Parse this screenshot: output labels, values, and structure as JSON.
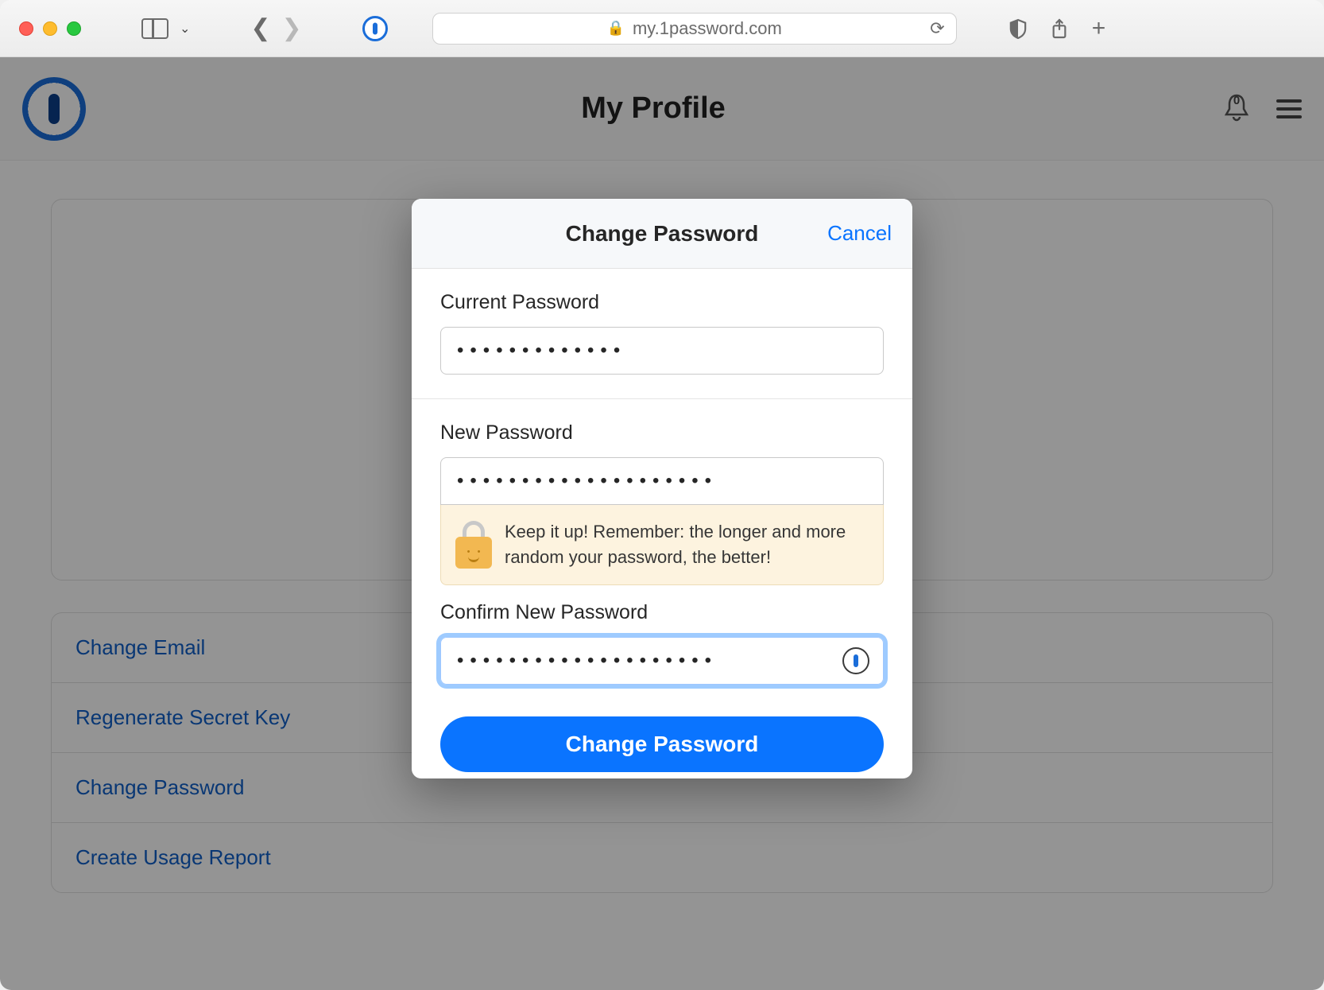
{
  "browser": {
    "url_display": "my.1password.com"
  },
  "page": {
    "title": "My Profile",
    "notification_count": "0",
    "menu_items": [
      {
        "label": "Change Email"
      },
      {
        "label": "Regenerate Secret Key"
      },
      {
        "label": "Change Password"
      },
      {
        "label": "Create Usage Report"
      }
    ]
  },
  "modal": {
    "title": "Change Password",
    "cancel": "Cancel",
    "current_label": "Current Password",
    "current_value": "•••••••••••••",
    "new_label": "New Password",
    "new_value": "••••••••••••••••••••",
    "tip": "Keep it up! Remember: the longer and more random your password, the better!",
    "confirm_label": "Confirm New Password",
    "confirm_value": "••••••••••••••••••••",
    "submit": "Change Password"
  }
}
